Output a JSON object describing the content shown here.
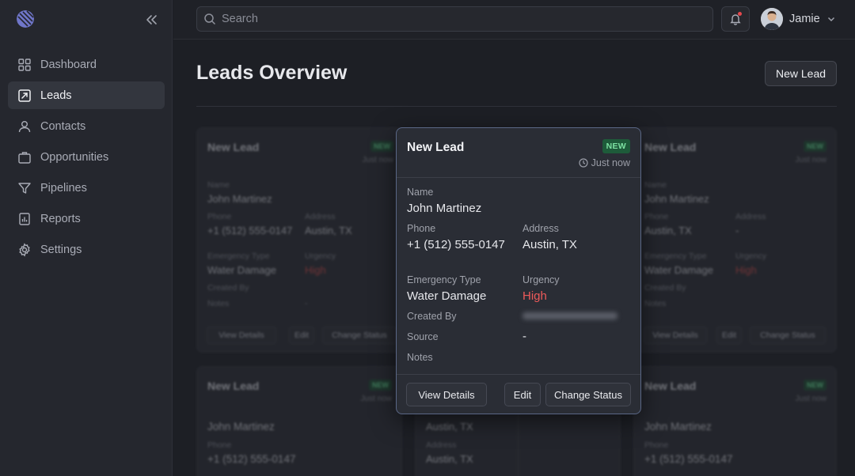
{
  "sidebar": {
    "items": [
      {
        "label": "Dashboard",
        "icon": "dashboard-icon"
      },
      {
        "label": "Leads",
        "icon": "leads-icon",
        "active": true
      },
      {
        "label": "Contacts",
        "icon": "contacts-icon"
      },
      {
        "label": "Opportunities",
        "icon": "briefcase-icon"
      },
      {
        "label": "Pipelines",
        "icon": "funnel-icon"
      },
      {
        "label": "Reports",
        "icon": "report-icon"
      },
      {
        "label": "Settings",
        "icon": "gear-icon"
      }
    ]
  },
  "topbar": {
    "search_placeholder": "Search",
    "user_name": "Jamie"
  },
  "main": {
    "title": "Leads Overview",
    "new_lead_label": "New Lead"
  },
  "popup": {
    "title": "New Lead",
    "badge": "NEW",
    "time": "Just now",
    "fields": {
      "name_label": "Name",
      "name": "John Martinez",
      "phone_label": "Phone",
      "phone": "+1 (512) 555-0147",
      "address_label": "Address",
      "address": "Austin, TX",
      "emergency_label": "Emergency Type",
      "emergency": "Water Damage",
      "urgency_label": "Urgency",
      "urgency": "High",
      "created_by_label": "Created By",
      "source_label": "Source",
      "source": "-",
      "notes_label": "Notes"
    },
    "buttons": {
      "view": "View Details",
      "edit": "Edit",
      "status": "Change Status"
    }
  },
  "bg_cards": [
    {
      "title": "New Lead",
      "badge": "NEW",
      "time": "Just now",
      "name_label": "Name",
      "name": "John Martinez",
      "phone_label": "Phone",
      "phone": "+1 (512) 555-0147",
      "address_label": "Address",
      "address": "Austin, TX",
      "emergency_label": "Emergency Type",
      "emergency": "Water Damage",
      "urgency_label": "Urgency",
      "urgency": "High",
      "created_by_label": "Created By",
      "notes_label": "Notes",
      "notes": "-",
      "btn_view": "View Details",
      "btn_edit": "Edit",
      "btn_status": "Change Status"
    },
    {
      "title": "New Lead",
      "badge": "NEW",
      "time": "Just now",
      "name_label": "Name",
      "name": "John Martinez",
      "phone_label": "Phone",
      "phone": "Austin, TX",
      "address_label": "Address",
      "address": "-",
      "emergency_label": "Emergency Type",
      "emergency": "Water Damage",
      "urgency_label": "Urgency",
      "urgency": "High",
      "created_by_label": "Created By",
      "notes_label": "Notes",
      "btn_view": "View Details",
      "btn_edit": "Edit",
      "btn_status": "Change Status"
    },
    {
      "title": "New Lead",
      "badge": "NEW",
      "time": "Just now",
      "name": "John Martinez",
      "phone_label": "Phone",
      "phone": "+1 (512) 555-0147"
    },
    {
      "value1": "Austin, TX",
      "address_label": "Address",
      "address": "Austin, TX"
    },
    {
      "title": "New Lead",
      "badge": "NEW",
      "time": "Just now",
      "name": "John Martinez",
      "phone_label": "Phone",
      "phone": "+1 (512) 555-0147"
    }
  ],
  "colors": {
    "accent_border": "#5a6786",
    "badge_green": "#7ee2a3",
    "urgency_high": "#ee5a5a"
  }
}
